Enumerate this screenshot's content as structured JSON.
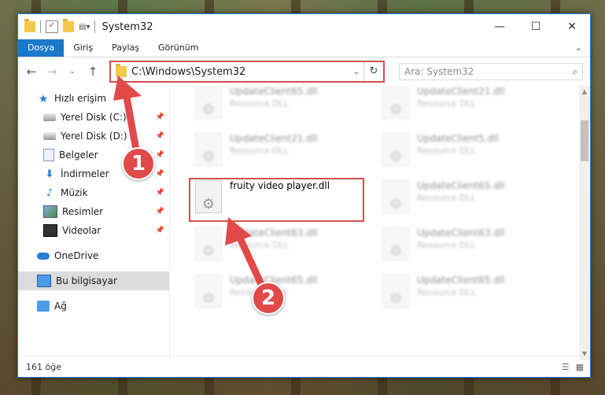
{
  "window": {
    "title": "System32"
  },
  "window_controls": {
    "minimize": "—",
    "maximize": "☐",
    "close": "✕"
  },
  "ribbon": {
    "tabs": [
      "Dosya",
      "Giriş",
      "Paylaş",
      "Görünüm"
    ]
  },
  "address": {
    "path": "C:\\Windows\\System32"
  },
  "search": {
    "placeholder": "Ara: System32"
  },
  "sidebar": {
    "items": [
      {
        "label": "Hızlı erişim",
        "icon": "star-icon"
      },
      {
        "label": "Yerel Disk (C:)",
        "icon": "disk-icon"
      },
      {
        "label": "Yerel Disk (D:)",
        "icon": "disk-icon"
      },
      {
        "label": "Belgeler",
        "icon": "document-icon"
      },
      {
        "label": "İndirmeler",
        "icon": "download-icon"
      },
      {
        "label": "Müzik",
        "icon": "music-icon"
      },
      {
        "label": "Resimler",
        "icon": "pictures-icon"
      },
      {
        "label": "Videolar",
        "icon": "video-icon"
      },
      {
        "label": "OneDrive",
        "icon": "cloud-icon"
      },
      {
        "label": "Bu bilgisayar",
        "icon": "computer-icon"
      },
      {
        "label": "Ağ",
        "icon": "network-icon"
      }
    ]
  },
  "files": [
    {
      "name": "UpdateClient65.dll",
      "type": "Resource DLL"
    },
    {
      "name": "UpdateClient21.dll",
      "type": "Resource DLL"
    },
    {
      "name": "UpdateClient21.dll",
      "type": "Resource DLL"
    },
    {
      "name": "UpdateClient5.dll",
      "type": "Resource DLL"
    },
    {
      "name": "fruity video player.dll",
      "type": ""
    },
    {
      "name": "UpdateClient65.dll",
      "type": "Resource DLL"
    },
    {
      "name": "UpdateClient63.dll",
      "type": "Resource DLL"
    },
    {
      "name": "UpdateClient63.dll",
      "type": "Resource DLL"
    },
    {
      "name": "UpdateClient65.dll",
      "type": "Resource DLL"
    },
    {
      "name": "UpdateClient65.dll",
      "type": "Resource DLL"
    }
  ],
  "status": {
    "count": "161 öğe"
  },
  "annotations": {
    "step1": "1",
    "step2": "2",
    "color": "#e24a4a"
  }
}
